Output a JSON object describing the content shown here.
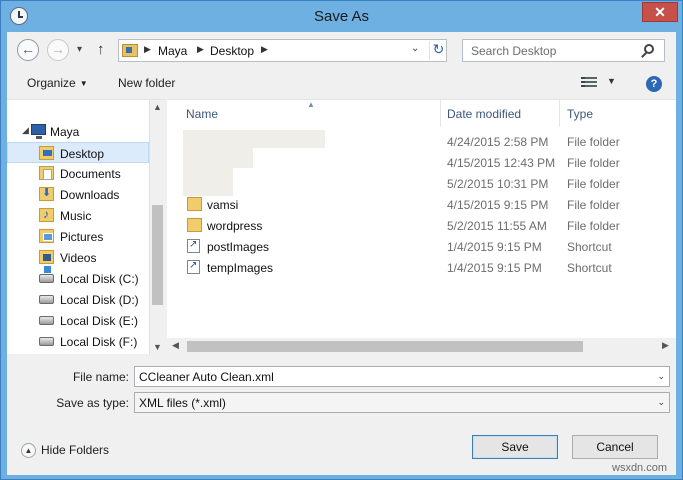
{
  "window": {
    "title": "Save As",
    "close_symbol": "✕"
  },
  "nav": {
    "back_icon": "back-arrow-icon",
    "forward_icon": "forward-arrow-icon",
    "breadcrumb": [
      "Maya",
      "Desktop"
    ],
    "search_placeholder": "Search Desktop"
  },
  "toolbar": {
    "organize_label": "Organize",
    "new_folder_label": "New folder"
  },
  "navpane": {
    "root": "Maya",
    "items": [
      {
        "label": "Desktop",
        "icon": "desktop-folder-icon",
        "selected": true
      },
      {
        "label": "Documents",
        "icon": "documents-folder-icon"
      },
      {
        "label": "Downloads",
        "icon": "downloads-folder-icon"
      },
      {
        "label": "Music",
        "icon": "music-folder-icon"
      },
      {
        "label": "Pictures",
        "icon": "pictures-folder-icon"
      },
      {
        "label": "Videos",
        "icon": "videos-folder-icon"
      },
      {
        "label": "Local Disk (C:)",
        "icon": "system-drive-icon"
      },
      {
        "label": "Local Disk (D:)",
        "icon": "drive-icon"
      },
      {
        "label": "Local Disk (E:)",
        "icon": "drive-icon"
      },
      {
        "label": "Local Disk (F:)",
        "icon": "drive-icon"
      }
    ]
  },
  "filelist": {
    "columns": {
      "name": "Name",
      "date": "Date modified",
      "type": "Type"
    },
    "rows": [
      {
        "name": "",
        "date": "4/24/2015 2:58 PM",
        "type": "File folder",
        "icon": "folder-icon"
      },
      {
        "name": "",
        "date": "4/15/2015 12:43 PM",
        "type": "File folder",
        "icon": "folder-icon"
      },
      {
        "name": "",
        "date": "5/2/2015 10:31 PM",
        "type": "File folder",
        "icon": "folder-icon"
      },
      {
        "name": "vamsi",
        "date": "4/15/2015 9:15 PM",
        "type": "File folder",
        "icon": "folder-icon"
      },
      {
        "name": "wordpress",
        "date": "5/2/2015 11:55 AM",
        "type": "File folder",
        "icon": "folder-icon"
      },
      {
        "name": "postImages",
        "date": "1/4/2015 9:15 PM",
        "type": "Shortcut",
        "icon": "shortcut-icon"
      },
      {
        "name": "tempImages",
        "date": "1/4/2015 9:15 PM",
        "type": "Shortcut",
        "icon": "shortcut-icon"
      }
    ]
  },
  "form": {
    "filename_label": "File name:",
    "filename_value": "CCleaner Auto Clean.xml",
    "type_label": "Save as type:",
    "type_value": "XML files (*.xml)"
  },
  "footer": {
    "hide_folders_label": "Hide Folders",
    "save_label": "Save",
    "cancel_label": "Cancel"
  },
  "watermark": "wsxdn.com"
}
